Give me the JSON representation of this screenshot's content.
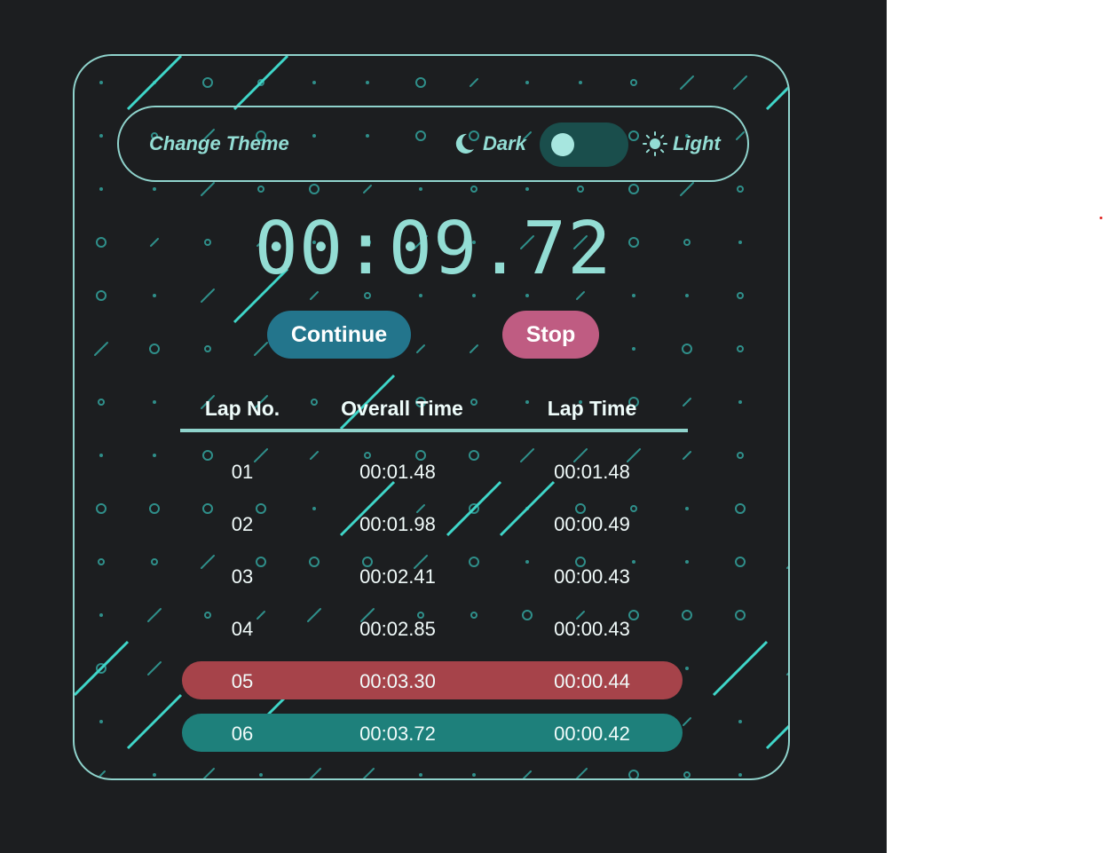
{
  "theme_bar": {
    "title": "Change Theme",
    "dark_label": "Dark",
    "light_label": "Light",
    "toggle_state": "dark"
  },
  "timer": {
    "display": "00:09.72"
  },
  "buttons": {
    "continue_label": "Continue",
    "stop_label": "Stop"
  },
  "laps": {
    "headers": [
      "Lap No.",
      "Overall Time",
      "Lap Time"
    ],
    "rows": [
      {
        "lap": "01",
        "overall": "00:01.48",
        "lap_time": "00:01.48",
        "highlight": "none"
      },
      {
        "lap": "02",
        "overall": "00:01.98",
        "lap_time": "00:00.49",
        "highlight": "none"
      },
      {
        "lap": "03",
        "overall": "00:02.41",
        "lap_time": "00:00.43",
        "highlight": "none"
      },
      {
        "lap": "04",
        "overall": "00:02.85",
        "lap_time": "00:00.43",
        "highlight": "none"
      },
      {
        "lap": "05",
        "overall": "00:03.30",
        "lap_time": "00:00.44",
        "highlight": "slowest"
      },
      {
        "lap": "06",
        "overall": "00:03.72",
        "lap_time": "00:00.42",
        "highlight": "fastest"
      }
    ]
  },
  "colors": {
    "background": "#1c1e20",
    "accent": "#8fd3cc",
    "continue_button": "#23758c",
    "stop_button": "#bf5c82",
    "slowest_lap": "#a6434a",
    "fastest_lap": "#1e807b",
    "toggle_track": "#1a4e4c"
  }
}
